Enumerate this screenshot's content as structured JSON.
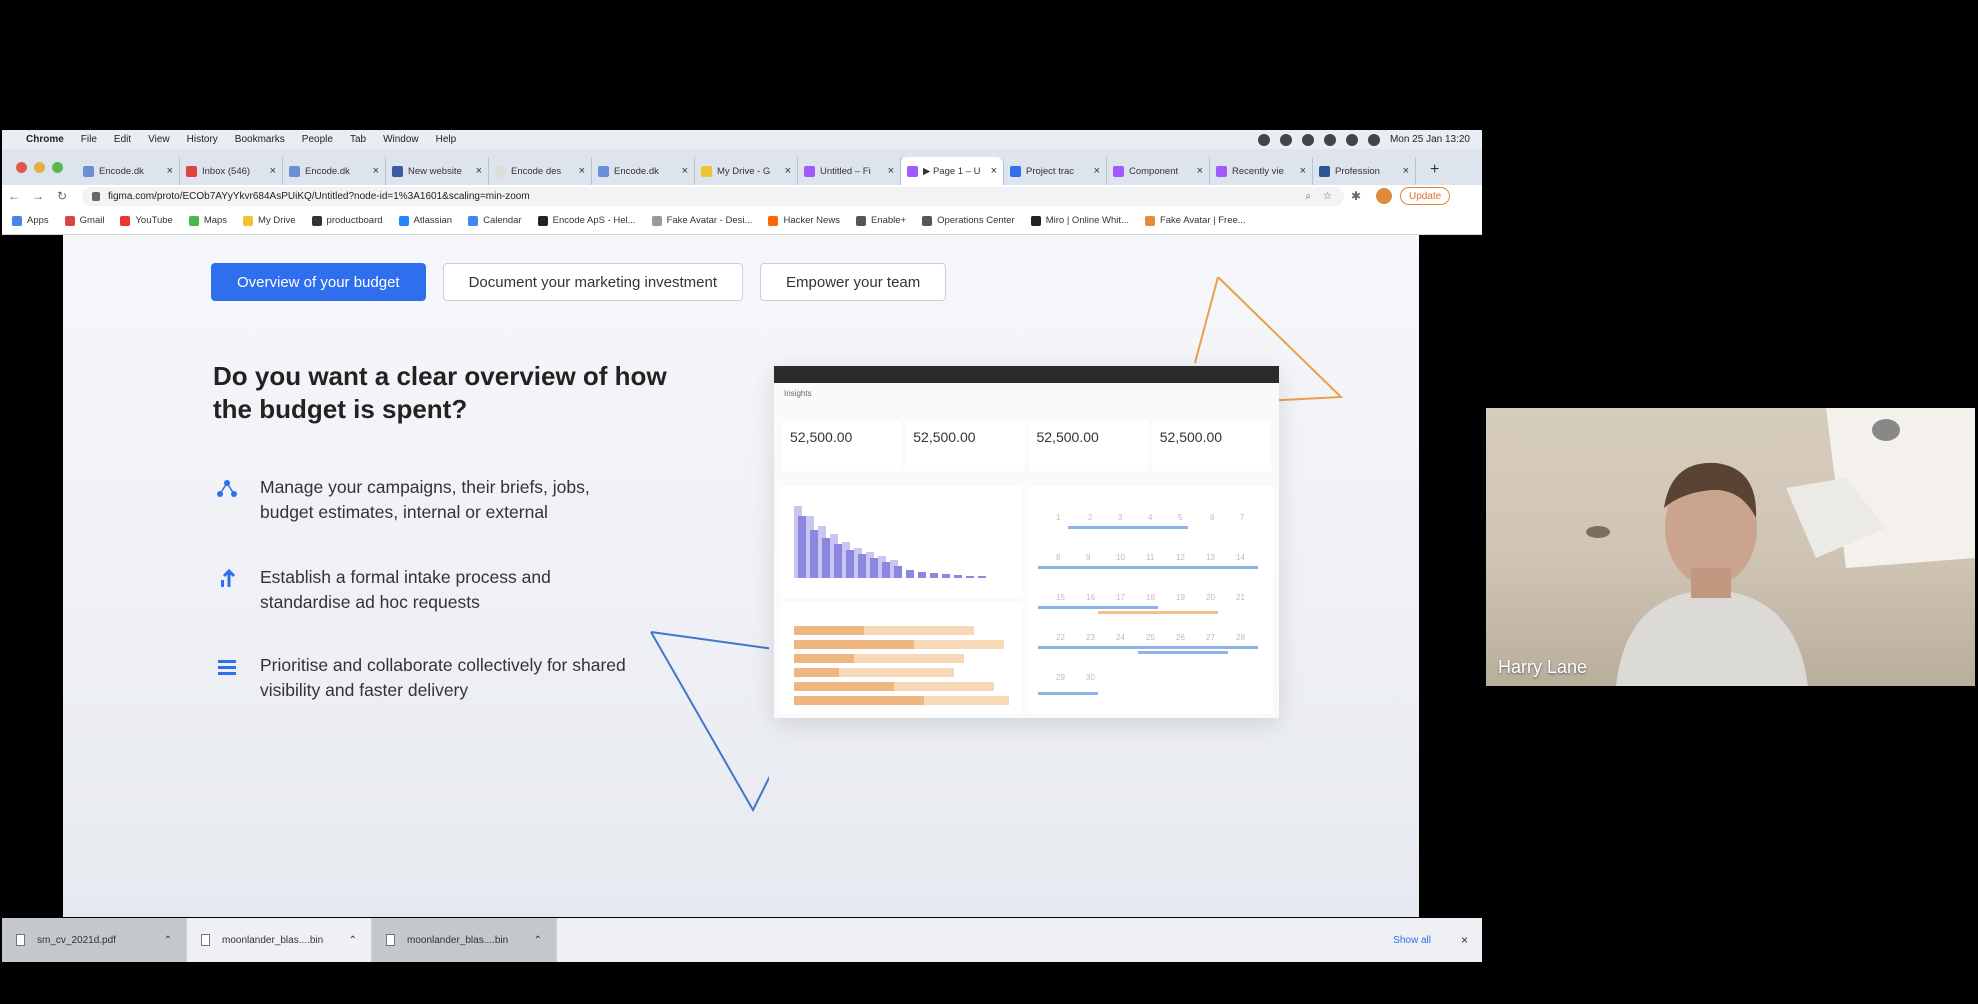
{
  "menubar": {
    "app": "Chrome",
    "items": [
      "File",
      "Edit",
      "View",
      "History",
      "Bookmarks",
      "People",
      "Tab",
      "Window",
      "Help"
    ],
    "datetime": "Mon 25 Jan 13:20"
  },
  "tabs": [
    {
      "label": "Encode.dk"
    },
    {
      "label": "Inbox (546)"
    },
    {
      "label": "Encode.dk"
    },
    {
      "label": "New website"
    },
    {
      "label": "Encode des"
    },
    {
      "label": "Encode.dk"
    },
    {
      "label": "My Drive - G"
    },
    {
      "label": "Untitled – Fi"
    },
    {
      "label": "▶ Page 1 – U"
    },
    {
      "label": "Project trac"
    },
    {
      "label": "Component"
    },
    {
      "label": "Recently vie"
    },
    {
      "label": "Profession"
    }
  ],
  "address": {
    "url": "figma.com/proto/ECOb7AYyYkvr684AsPUiKQ/Untitled?node-id=1%3A1601&scaling=min-zoom",
    "update_label": "Update"
  },
  "bookmarks": [
    "Apps",
    "Gmail",
    "YouTube",
    "Maps",
    "My Drive",
    "productboard",
    "Atlassian",
    "Calendar",
    "Encode ApS - Hel...",
    "Fake Avatar - Desi...",
    "Hacker News",
    "Enable+",
    "Operations Center",
    "Miro | Online Whit...",
    "Fake Avatar | Free..."
  ],
  "page": {
    "tabs": [
      {
        "label": "Overview of your budget"
      },
      {
        "label": "Document your marketing investment"
      },
      {
        "label": "Empower your team"
      }
    ],
    "headline": "Do you want a clear overview of how the budget is spent?",
    "features": [
      {
        "icon": "nodes-icon",
        "text": "Manage your campaigns, their briefs, jobs, budget estimates, internal or external"
      },
      {
        "icon": "arrow-up-icon",
        "text": "Establish a formal intake process and standardise ad hoc requests"
      },
      {
        "icon": "list-icon",
        "text": "Prioritise and collaborate collectively for shared visibility and faster delivery"
      }
    ],
    "dashboard": {
      "crumb": "Insights",
      "stats": [
        "52,500.00",
        "52,500.00",
        "52,500.00",
        "52,500.00"
      ],
      "calendar": [
        "1",
        "2",
        "3",
        "4",
        "5",
        "6",
        "7",
        "8",
        "9",
        "10",
        "11",
        "12",
        "13",
        "14",
        "15",
        "16",
        "17",
        "18",
        "19",
        "20",
        "21",
        "22",
        "23",
        "24",
        "25",
        "26",
        "27",
        "28",
        "29",
        "30"
      ]
    }
  },
  "downloads": {
    "items": [
      {
        "name": "sm_cv_2021d.pdf"
      },
      {
        "name": "moonlander_blas....bin"
      },
      {
        "name": "moonlander_blas....bin"
      }
    ],
    "show_all": "Show all"
  },
  "video": {
    "participant": "Harry Lane"
  },
  "colors": {
    "accent": "#2f6fed",
    "triangle_orange": "#e8a04a",
    "triangle_blue": "#3f78c8"
  }
}
